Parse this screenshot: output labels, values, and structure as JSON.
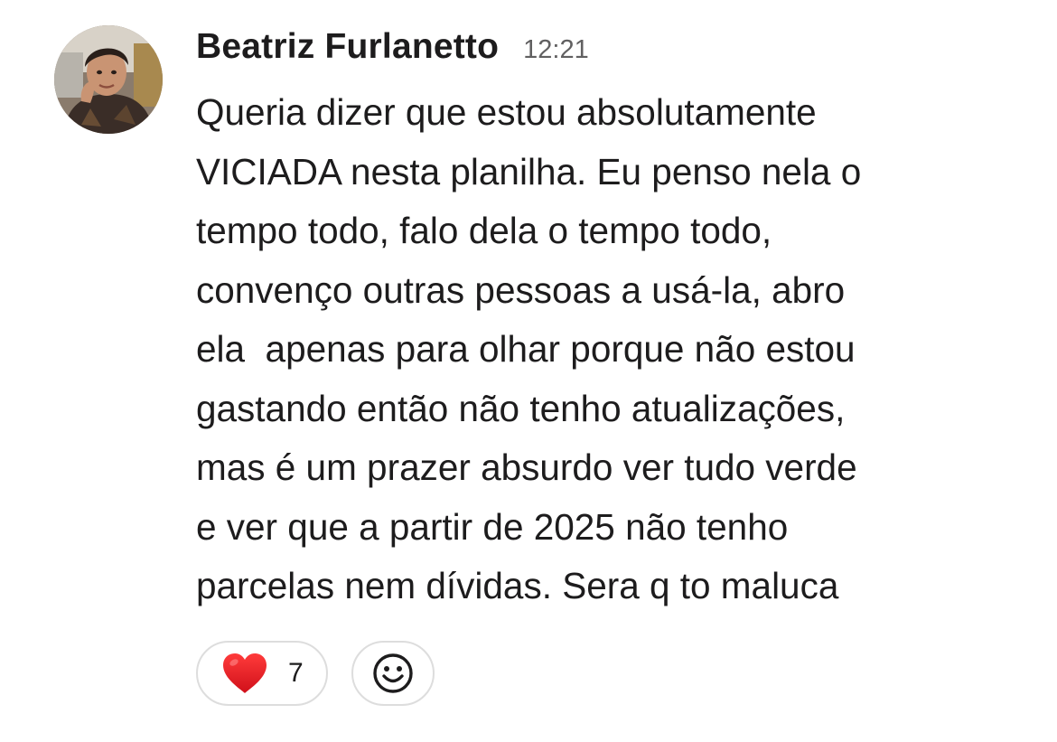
{
  "message": {
    "author": "Beatriz Furlanetto",
    "timestamp": "12:21",
    "lines": [
      "Queria dizer que estou absolutamente",
      "VICIADA nesta planilha. Eu penso nela o",
      "tempo todo, falo dela o tempo todo,",
      "convenço outras pessoas a usá-la, abro",
      "ela  apenas para olhar porque não estou",
      "gastando então não tenho atualizações,",
      "mas é um prazer absurdo ver tudo verde",
      "e ver que a partir de 2025 não tenho",
      "parcelas nem dívidas. Sera q to maluca"
    ]
  },
  "reactions": [
    {
      "emoji_icon": "red-heart-icon",
      "count": "7"
    }
  ],
  "add_reaction": {
    "icon": "smiley-face-icon"
  },
  "colors": {
    "text": "#1d1c1d",
    "timestamp": "#616061",
    "pill_border": "#dddddd",
    "heart": "#e0121c"
  }
}
